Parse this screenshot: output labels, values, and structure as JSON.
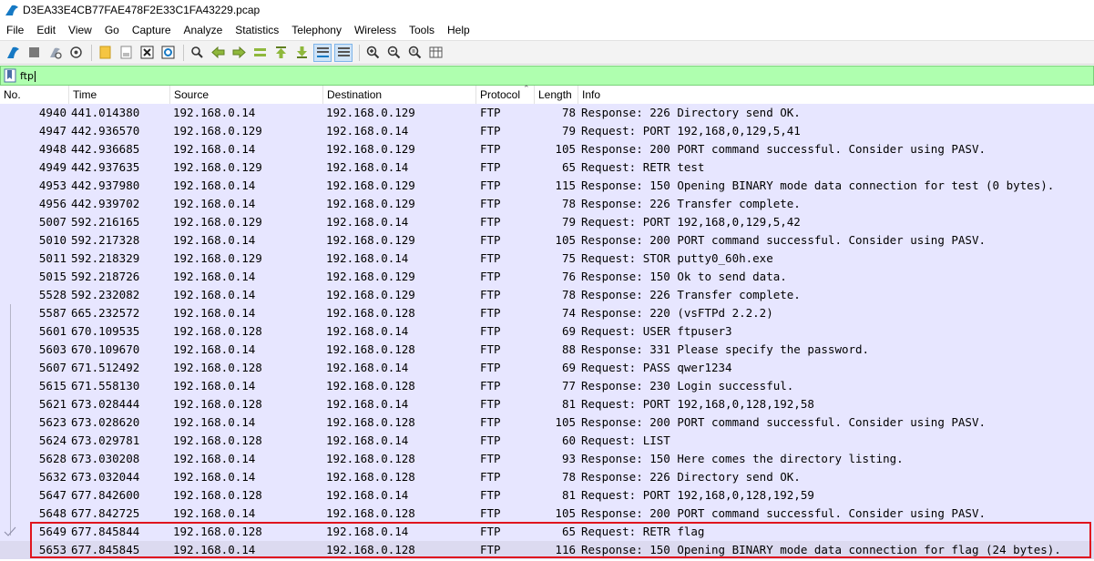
{
  "window": {
    "title": "D3EA33E4CB77FAE478F2E33C1FA43229.pcap"
  },
  "menu": [
    "File",
    "Edit",
    "View",
    "Go",
    "Capture",
    "Analyze",
    "Statistics",
    "Telephony",
    "Wireless",
    "Tools",
    "Help"
  ],
  "toolbar": {
    "icons": [
      "shark-fin-start-icon",
      "stop-square-icon",
      "restart-capture-icon",
      "capture-options-gear-icon",
      "open-folder-icon",
      "save-file-icon",
      "close-file-icon",
      "reload-file-icon",
      "find-packet-icon",
      "go-back-icon",
      "go-forward-icon",
      "go-to-packet-icon",
      "go-first-icon",
      "go-last-icon",
      "auto-scroll-icon",
      "colorize-icon",
      "zoom-in-icon",
      "zoom-out-icon",
      "zoom-normal-icon",
      "resize-columns-icon"
    ]
  },
  "filter": {
    "value": "ftp"
  },
  "columns": {
    "no": "No.",
    "time": "Time",
    "source": "Source",
    "destination": "Destination",
    "protocol": "Protocol",
    "length": "Length",
    "info": "Info"
  },
  "packets": [
    {
      "no": "4940",
      "time": "441.014380",
      "src": "192.168.0.14",
      "dst": "192.168.0.129",
      "proto": "FTP",
      "len": "78",
      "info": "Response: 226 Directory send OK."
    },
    {
      "no": "4947",
      "time": "442.936570",
      "src": "192.168.0.129",
      "dst": "192.168.0.14",
      "proto": "FTP",
      "len": "79",
      "info": "Request: PORT 192,168,0,129,5,41"
    },
    {
      "no": "4948",
      "time": "442.936685",
      "src": "192.168.0.14",
      "dst": "192.168.0.129",
      "proto": "FTP",
      "len": "105",
      "info": "Response: 200 PORT command successful. Consider using PASV."
    },
    {
      "no": "4949",
      "time": "442.937635",
      "src": "192.168.0.129",
      "dst": "192.168.0.14",
      "proto": "FTP",
      "len": "65",
      "info": "Request: RETR test"
    },
    {
      "no": "4953",
      "time": "442.937980",
      "src": "192.168.0.14",
      "dst": "192.168.0.129",
      "proto": "FTP",
      "len": "115",
      "info": "Response: 150 Opening BINARY mode data connection for test (0 bytes)."
    },
    {
      "no": "4956",
      "time": "442.939702",
      "src": "192.168.0.14",
      "dst": "192.168.0.129",
      "proto": "FTP",
      "len": "78",
      "info": "Response: 226 Transfer complete."
    },
    {
      "no": "5007",
      "time": "592.216165",
      "src": "192.168.0.129",
      "dst": "192.168.0.14",
      "proto": "FTP",
      "len": "79",
      "info": "Request: PORT 192,168,0,129,5,42"
    },
    {
      "no": "5010",
      "time": "592.217328",
      "src": "192.168.0.14",
      "dst": "192.168.0.129",
      "proto": "FTP",
      "len": "105",
      "info": "Response: 200 PORT command successful. Consider using PASV."
    },
    {
      "no": "5011",
      "time": "592.218329",
      "src": "192.168.0.129",
      "dst": "192.168.0.14",
      "proto": "FTP",
      "len": "75",
      "info": "Request: STOR putty0_60h.exe"
    },
    {
      "no": "5015",
      "time": "592.218726",
      "src": "192.168.0.14",
      "dst": "192.168.0.129",
      "proto": "FTP",
      "len": "76",
      "info": "Response: 150 Ok to send data."
    },
    {
      "no": "5528",
      "time": "592.232082",
      "src": "192.168.0.14",
      "dst": "192.168.0.129",
      "proto": "FTP",
      "len": "78",
      "info": "Response: 226 Transfer complete."
    },
    {
      "no": "5587",
      "time": "665.232572",
      "src": "192.168.0.14",
      "dst": "192.168.0.128",
      "proto": "FTP",
      "len": "74",
      "info": "Response: 220 (vsFTPd 2.2.2)"
    },
    {
      "no": "5601",
      "time": "670.109535",
      "src": "192.168.0.128",
      "dst": "192.168.0.14",
      "proto": "FTP",
      "len": "69",
      "info": "Request: USER ftpuser3"
    },
    {
      "no": "5603",
      "time": "670.109670",
      "src": "192.168.0.14",
      "dst": "192.168.0.128",
      "proto": "FTP",
      "len": "88",
      "info": "Response: 331 Please specify the password."
    },
    {
      "no": "5607",
      "time": "671.512492",
      "src": "192.168.0.128",
      "dst": "192.168.0.14",
      "proto": "FTP",
      "len": "69",
      "info": "Request: PASS qwer1234"
    },
    {
      "no": "5615",
      "time": "671.558130",
      "src": "192.168.0.14",
      "dst": "192.168.0.128",
      "proto": "FTP",
      "len": "77",
      "info": "Response: 230 Login successful."
    },
    {
      "no": "5621",
      "time": "673.028444",
      "src": "192.168.0.128",
      "dst": "192.168.0.14",
      "proto": "FTP",
      "len": "81",
      "info": "Request: PORT 192,168,0,128,192,58"
    },
    {
      "no": "5623",
      "time": "673.028620",
      "src": "192.168.0.14",
      "dst": "192.168.0.128",
      "proto": "FTP",
      "len": "105",
      "info": "Response: 200 PORT command successful. Consider using PASV."
    },
    {
      "no": "5624",
      "time": "673.029781",
      "src": "192.168.0.128",
      "dst": "192.168.0.14",
      "proto": "FTP",
      "len": "60",
      "info": "Request: LIST"
    },
    {
      "no": "5628",
      "time": "673.030208",
      "src": "192.168.0.14",
      "dst": "192.168.0.128",
      "proto": "FTP",
      "len": "93",
      "info": "Response: 150 Here comes the directory listing."
    },
    {
      "no": "5632",
      "time": "673.032044",
      "src": "192.168.0.14",
      "dst": "192.168.0.128",
      "proto": "FTP",
      "len": "78",
      "info": "Response: 226 Directory send OK."
    },
    {
      "no": "5647",
      "time": "677.842600",
      "src": "192.168.0.128",
      "dst": "192.168.0.14",
      "proto": "FTP",
      "len": "81",
      "info": "Request: PORT 192,168,0,128,192,59"
    },
    {
      "no": "5648",
      "time": "677.842725",
      "src": "192.168.0.14",
      "dst": "192.168.0.128",
      "proto": "FTP",
      "len": "105",
      "info": "Response: 200 PORT command successful. Consider using PASV."
    },
    {
      "no": "5649",
      "time": "677.845844",
      "src": "192.168.0.128",
      "dst": "192.168.0.14",
      "proto": "FTP",
      "len": "65",
      "info": "Request: RETR flag"
    },
    {
      "no": "5653",
      "time": "677.845845",
      "src": "192.168.0.14",
      "dst": "192.168.0.128",
      "proto": "FTP",
      "len": "116",
      "info": "Response: 150 Opening BINARY mode data connection for flag (24 bytes)."
    }
  ],
  "colors": {
    "row_bg": "#e7e6ff",
    "filter_bg": "#afffaf",
    "highlight_box": "#e0141e"
  },
  "highlight": {
    "packets": [
      "5649",
      "5653"
    ]
  }
}
